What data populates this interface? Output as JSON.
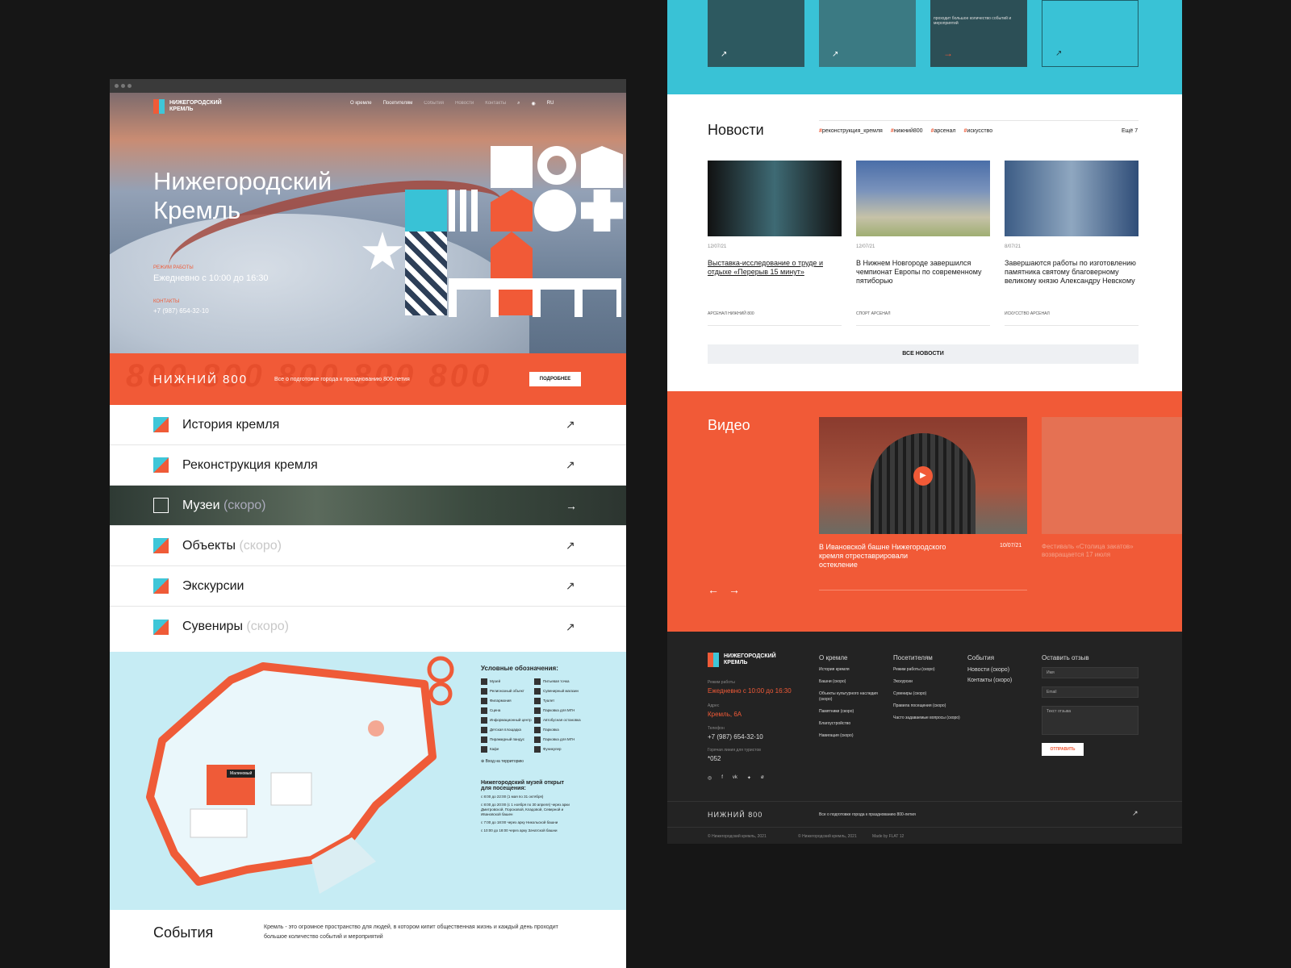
{
  "left": {
    "logo": "НИЖЕГОРОДСКИЙ КРЕМЛЬ",
    "nav": [
      "О кремле",
      "Посетителям",
      "События",
      "Новости",
      "Контакты"
    ],
    "lang": "RU",
    "title": "Нижегородский Кремль",
    "hours_label": "Режим работы",
    "hours": "Ежедневно с 10:00 до 16:30",
    "contacts_label": "Контакты",
    "phone": "+7 (987) 654-32-10",
    "banner": {
      "brand": "НИЖНИЙ 800",
      "text": "Все о подготовке города к празднованию 800-летия",
      "button": "ПОДРОБНЕЕ",
      "bg": "800 800 800 800 800"
    },
    "menu": [
      {
        "label": "История кремля",
        "soon": ""
      },
      {
        "label": "Реконструкция кремля",
        "soon": ""
      },
      {
        "label": "Музеи",
        "soon": "(скоро)"
      },
      {
        "label": "Объекты",
        "soon": "(скоро)"
      },
      {
        "label": "Экскурсии",
        "soon": ""
      },
      {
        "label": "Сувениры",
        "soon": "(скоро)"
      }
    ],
    "arrow": "↗",
    "legend_title": "Условные обозначения:",
    "legend_items": [
      "Музей",
      "Питьевая точка",
      "Религиозный объект",
      "Сувенирный магазин",
      "Филармония",
      "Туалет",
      "Сцена",
      "Парковка для МГН",
      "Информационный центр",
      "Автобусная остановка",
      "Детская площадка",
      "Парковка",
      "Пирамидный пандус",
      "Парковка для МГН",
      "Кафе",
      "Фуникулер"
    ],
    "entrance": "Вход на территорию",
    "museum_title": "Нижегородский музей открыт для посещения:",
    "museum_lines": [
      "с 8:00 до 22:00 (1 мая по 31 октября)",
      "с 8:00 до 20:00 (с 1 ноября по 30 апреля) через арки Дмитровской, Пороховой, Кладовой, Северной и Ивановской башен",
      "с 7:00 до 18:00 через арку Никольской башни",
      "с 10:00 до 18:00 через арку Зачатской башни"
    ],
    "map_tag": "Малиновый",
    "events_title": "События",
    "events_text": "Кремль - это огромное пространство для людей, в котором кипит общественная жизнь и каждый день проходит большое количество событий и мероприятий"
  },
  "right": {
    "top_text": "проходит большое количество событий и мероприятий",
    "news_title": "Новости",
    "tags": [
      "реконструкция_кремля",
      "нижний800",
      "арсенал",
      "искусство"
    ],
    "more": "Ещё 7",
    "news": [
      {
        "date": "12/07/21",
        "title": "Выставка-исследование о труде и отдыхе «Перерыв 15 минут»",
        "tags": "АРСЕНАЛ  НИЖНИЙ 800"
      },
      {
        "date": "12/07/21",
        "title": "В Нижнем Новгороде завершился чемпионат Европы по современному пятиборью",
        "tags": "СПОРТ  АРСЕНАЛ"
      },
      {
        "date": "8/07/21",
        "title": "Завершаются работы по изготовлению памятника святому благоверному великому князю Александру Невскому",
        "tags": "ИСКУССТВО  АРСЕНАЛ"
      }
    ],
    "all_news": "ВСЕ НОВОСТИ",
    "video_title": "Видео",
    "videos": [
      {
        "title": "В Ивановской башне Нижегородского кремля отреставрировали остекление",
        "date": "10/07/21"
      },
      {
        "title": "Фестиваль «Столица закатов» возвращается 17 июля",
        "date": ""
      }
    ],
    "footer": {
      "logo": "НИЖЕГОРОДСКИЙ КРЕМЛЬ",
      "hours_label": "Режим работы",
      "hours": "Ежедневно с 10:00 до 16:30",
      "addr_label": "Адрес",
      "addr": "Кремль, 6А",
      "phone_label": "Телефон",
      "phone": "+7 (987) 654-32-10",
      "short_label": "Горячая линия для туристов",
      "short": "*052",
      "col1_title": "О кремле",
      "col1": [
        "История кремля",
        "Башни (скоро)",
        "Объекты культурного наследия (скоро)",
        "Памятники (скоро)",
        "Благоустройство",
        "Навигация (скоро)"
      ],
      "col2_title": "Посетителям",
      "col2": [
        "Режим работы (скоро)",
        "Экскурсии",
        "Сувениры (скоро)",
        "Правила посещения (скоро)",
        "Часто задаваемые вопросы (скоро)"
      ],
      "col3_title": "События",
      "col3": [
        "Новости (скоро)",
        "Контакты (скоро)"
      ],
      "form_title": "Оставить отзыв",
      "name_ph": "Имя",
      "email_ph": "Email",
      "text_ph": "Текст отзыва",
      "send": "ОТПРАВИТЬ",
      "brand": "НИЖНИЙ 800",
      "brand_text": "Все о подготовке города к празднованию 800-летия",
      "copy1": "© Нижегородский кремль, 2021",
      "copy2": "© Нижегородский кремль, 2021",
      "made": "Made by FLAT 12"
    }
  },
  "colors": {
    "accent": "#f15a37",
    "cyan": "#39c2d6",
    "dark": "#232323"
  }
}
